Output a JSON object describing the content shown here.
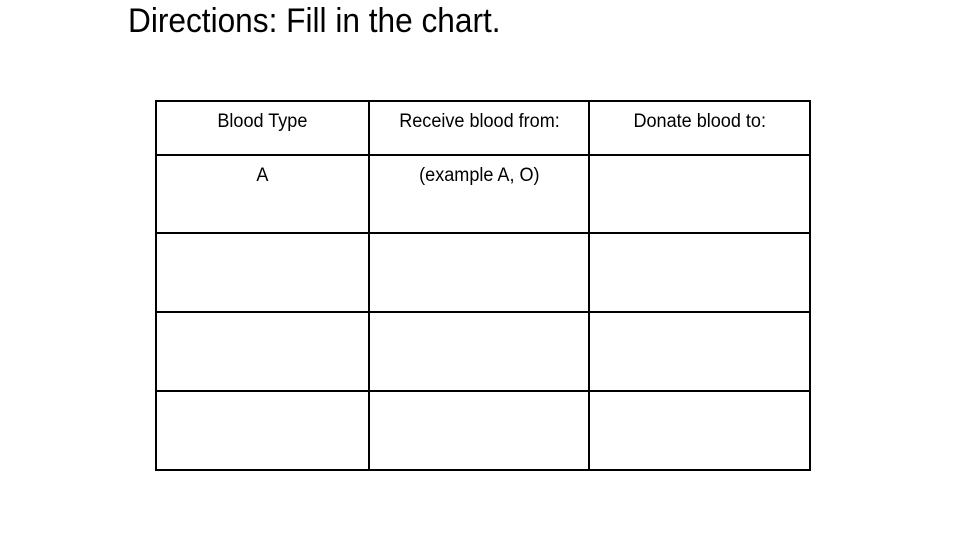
{
  "title": "Directions: Fill in the chart.",
  "table": {
    "headers": [
      "Blood Type",
      "Receive blood from:",
      "Donate blood to:"
    ],
    "rows": [
      [
        "A",
        "(example A, O)",
        ""
      ],
      [
        "",
        "",
        ""
      ],
      [
        "",
        "",
        ""
      ],
      [
        "",
        "",
        ""
      ]
    ]
  }
}
